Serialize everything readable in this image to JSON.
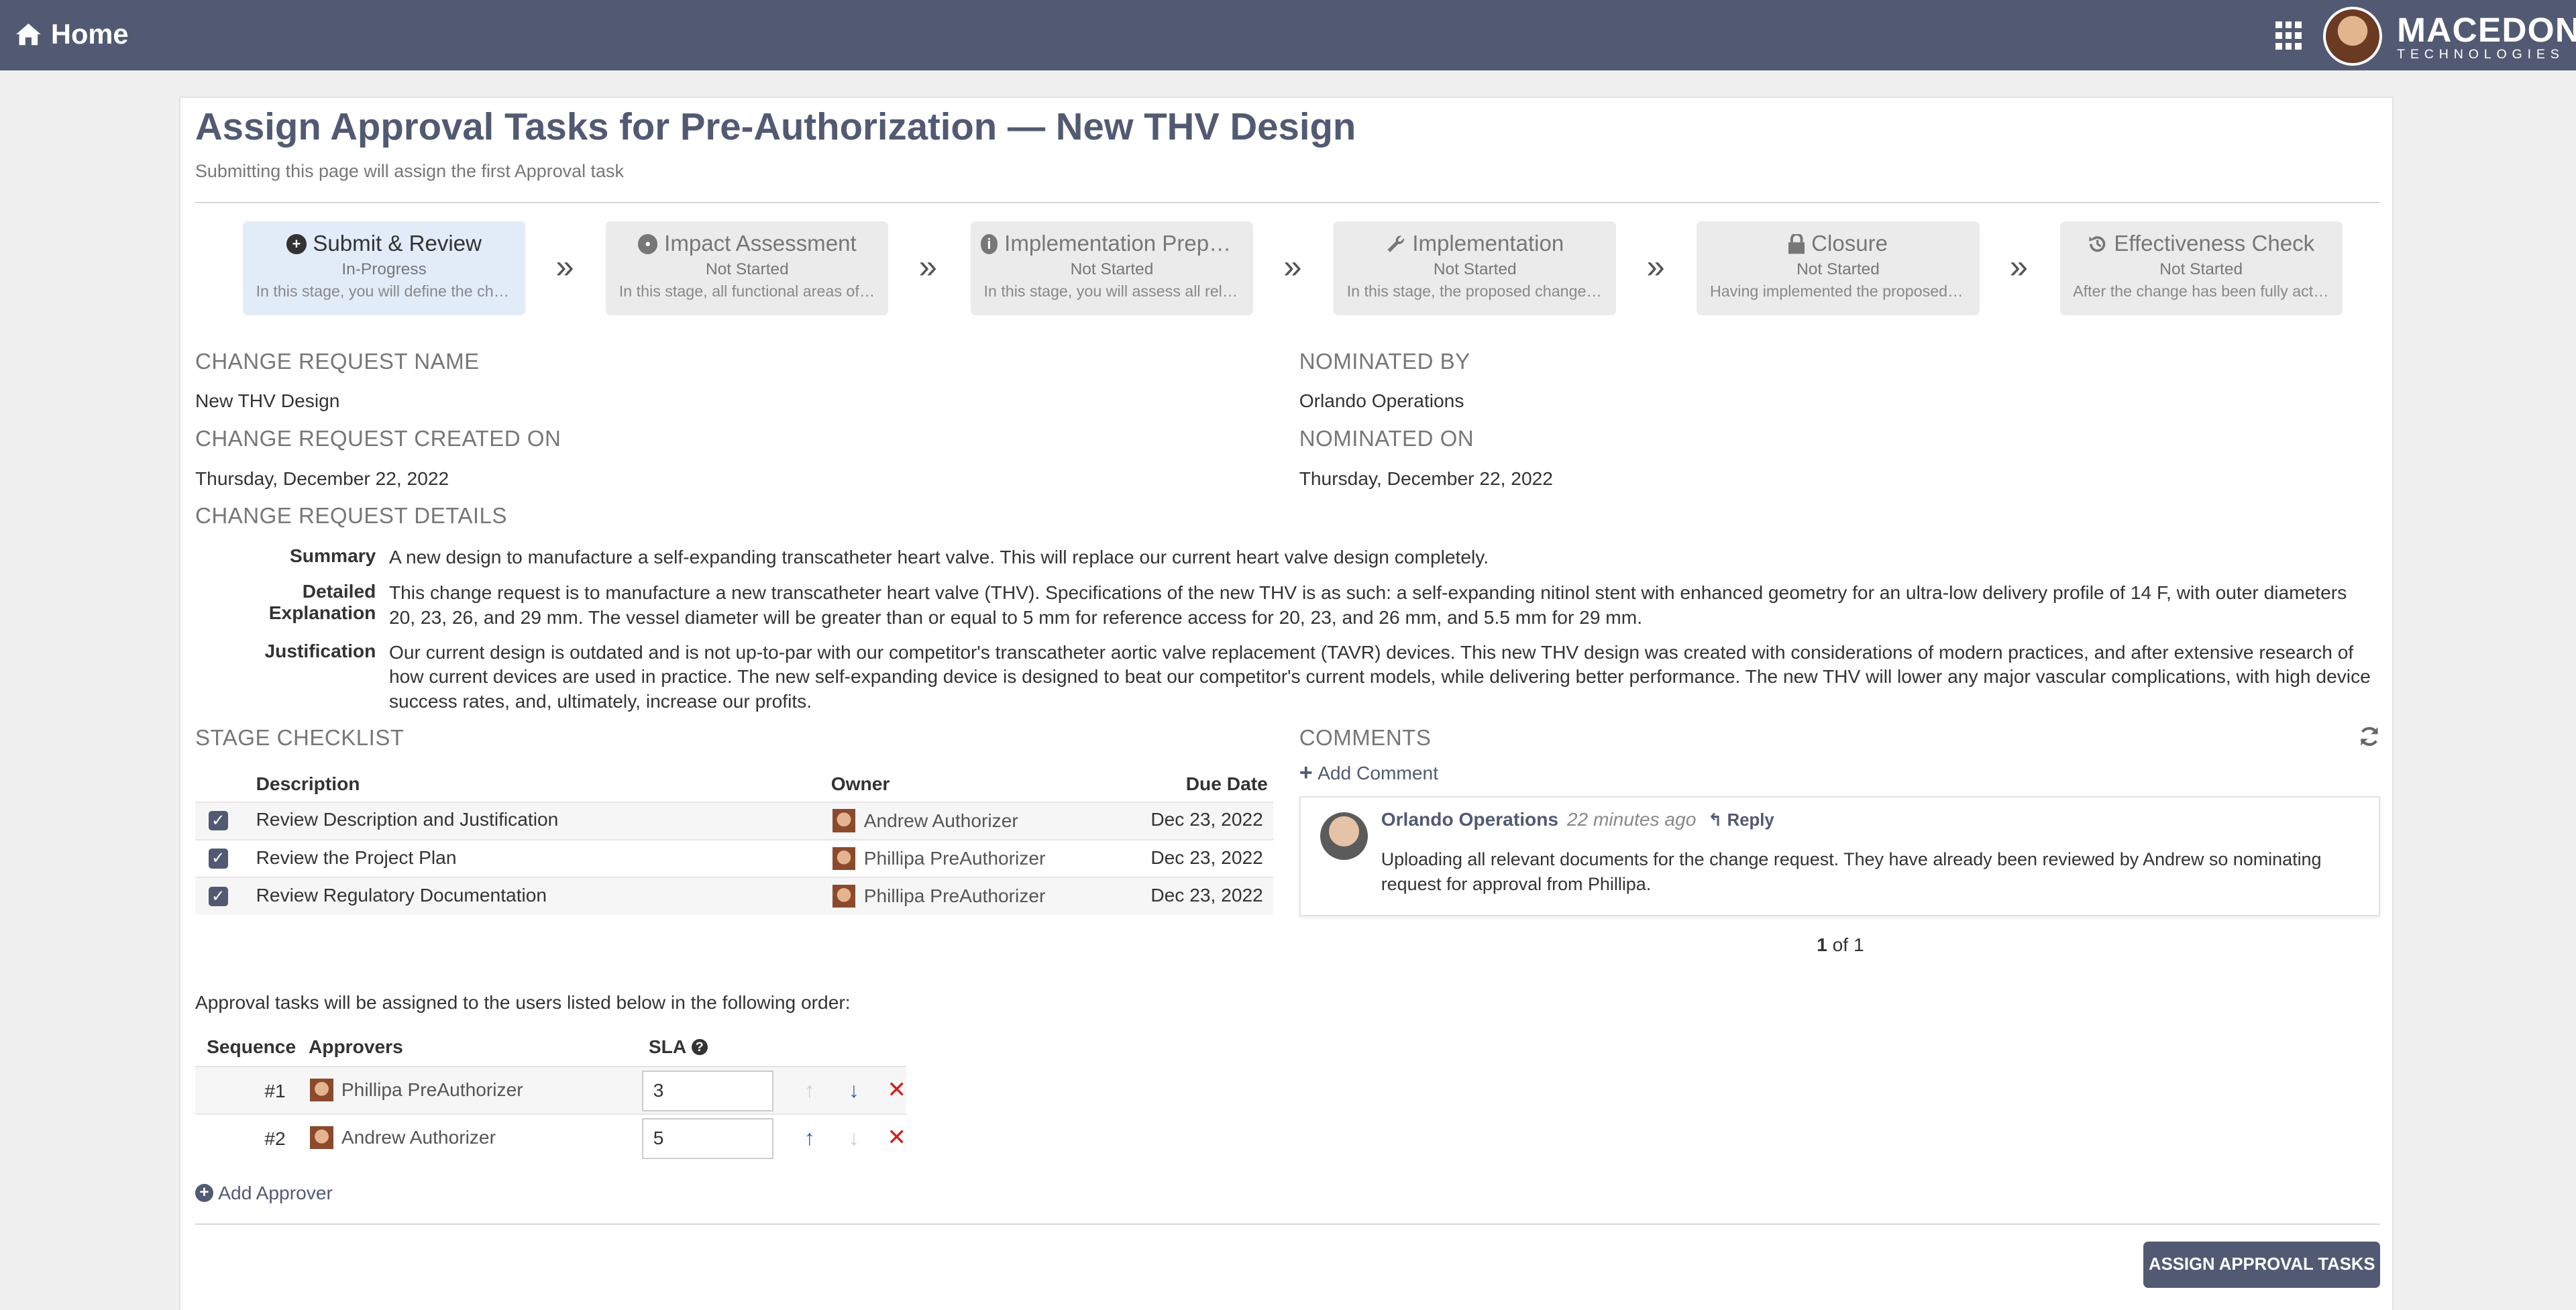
{
  "header": {
    "home_label": "Home",
    "brand_name": "MACEDON",
    "brand_sub": "TECHNOLOGIES"
  },
  "page": {
    "title": "Assign Approval Tasks for Pre-Authorization — New THV Design",
    "subtitle": "Submitting this page will assign the first Approval task"
  },
  "stages": [
    {
      "title": "Submit & Review",
      "status": "In-Progress",
      "desc": "In this stage, you will define the change request",
      "icon": "plus-circle-icon",
      "active": true
    },
    {
      "title": "Impact Assessment",
      "status": "Not Started",
      "desc": "In this stage, all functional areas of the organization",
      "icon": "dot-circle-icon",
      "active": false
    },
    {
      "title": "Implementation Preparation",
      "status": "Not Started",
      "desc": "In this stage, you will assess all relevant items",
      "icon": "info-circle-icon",
      "active": false
    },
    {
      "title": "Implementation",
      "status": "Not Started",
      "desc": "In this stage, the proposed change will be implemented",
      "icon": "wrench-icon",
      "active": false
    },
    {
      "title": "Closure",
      "status": "Not Started",
      "desc": "Having implemented the proposed change",
      "icon": "lock-icon",
      "active": false
    },
    {
      "title": "Effectiveness Check",
      "status": "Not Started",
      "desc": "After the change has been fully actioned",
      "icon": "history-icon",
      "active": false
    }
  ],
  "info": {
    "cr_name_label": "CHANGE REQUEST NAME",
    "cr_name": "New THV Design",
    "nominated_by_label": "NOMINATED BY",
    "nominated_by": "Orlando Operations",
    "created_on_label": "CHANGE REQUEST CREATED ON",
    "created_on": "Thursday, December 22, 2022",
    "nominated_on_label": "NOMINATED ON",
    "nominated_on": "Thursday, December 22, 2022",
    "details_label": "CHANGE REQUEST DETAILS"
  },
  "details": [
    {
      "key": "Summary",
      "value": "A new design to manufacture a self-expanding transcatheter heart valve. This will replace our current heart valve design completely."
    },
    {
      "key": "Detailed Explanation",
      "value": "This change request is to manufacture a new transcatheter heart valve (THV). Specifications of the new THV is as such: a self-expanding nitinol stent with enhanced geometry for an ultra-low delivery profile of 14 F, with outer diameters 20, 23, 26, and 29 mm. The vessel diameter will be greater than or equal to 5 mm for reference access for 20, 23, and 26 mm, and 5.5 mm for 29 mm."
    },
    {
      "key": "Justification",
      "value": "Our current design is outdated and is not up-to-par with our competitor's transcatheter aortic valve replacement (TAVR) devices. This new THV design was created with considerations of modern practices, and after extensive research of how current devices are used in practice. The new self-expanding device is designed to beat our competitor's current models, while delivering better performance. The new THV will lower any major vascular complications, with high device success rates, and, ultimately, increase our profits."
    }
  ],
  "checklist": {
    "label": "STAGE CHECKLIST",
    "headers": {
      "description": "Description",
      "owner": "Owner",
      "due": "Due Date"
    },
    "rows": [
      {
        "description": "Review Description and Justification",
        "owner": "Andrew Authorizer",
        "due": "Dec 23, 2022",
        "checked": true
      },
      {
        "description": "Review the Project Plan",
        "owner": "Phillipa PreAuthorizer",
        "due": "Dec 23, 2022",
        "checked": true
      },
      {
        "description": "Review Regulatory Documentation",
        "owner": "Phillipa PreAuthorizer",
        "due": "Dec 23, 2022",
        "checked": true
      }
    ]
  },
  "comments": {
    "label": "COMMENTS",
    "add_label": "Add Comment",
    "items": [
      {
        "author": "Orlando Operations",
        "time": "22 minutes ago",
        "reply": "Reply",
        "text": "Uploading all relevant documents for the change request. They have already been reviewed by Andrew so nominating request for approval from Phillipa."
      }
    ],
    "pager_current": "1",
    "pager_rest": " of 1"
  },
  "approvers": {
    "intro": "Approval tasks will be assigned to the users listed below in the following order:",
    "headers": {
      "sequence": "Sequence",
      "approvers": "Approvers",
      "sla": "SLA"
    },
    "rows": [
      {
        "seq": "#1",
        "name": "Phillipa PreAuthorizer",
        "sla": "3"
      },
      {
        "seq": "#2",
        "name": "Andrew Authorizer",
        "sla": "5"
      }
    ],
    "add_label": "Add Approver"
  },
  "actions": {
    "assign_label": "ASSIGN APPROVAL TASKS"
  },
  "colors": {
    "header_bg": "#525a73",
    "accent": "#525a73",
    "active_stage": "#e2ecf8",
    "delete": "#d31d1d",
    "move": "#2a5fb0"
  }
}
